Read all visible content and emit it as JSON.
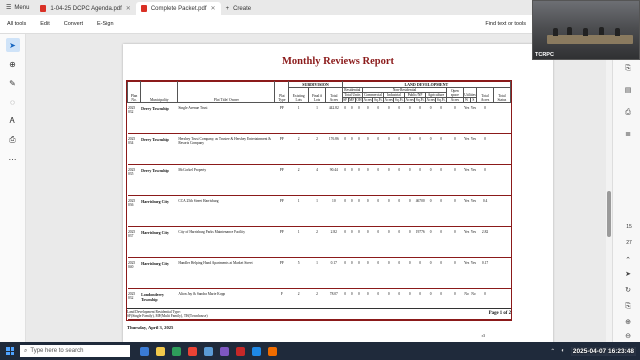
{
  "browser": {
    "menu_label": "Menu",
    "tabs": [
      {
        "label": "1-04-25 DCPC Agenda.pdf",
        "active": false
      },
      {
        "label": "Complete Packet.pdf",
        "active": true
      },
      {
        "label": "Create",
        "active": false
      }
    ]
  },
  "toolbar": {
    "items": [
      "All tools",
      "Edit",
      "Convert",
      "E-Sign"
    ],
    "find_label": "Find text or tools"
  },
  "report": {
    "title": "Monthly Reviews Report",
    "group_headers": {
      "subdivision": "SUBDIVISION",
      "land_development": "LAND DEVELOPMENT"
    },
    "sub_headers": {
      "residential": "Residential",
      "non_residential": "Non-Residential",
      "total_units": "Total Units",
      "commercial": "Commercial",
      "industrial": "Industrial",
      "public_np": "Public/NP",
      "agriculture": "Agriculture",
      "open_space": "Open space",
      "utilities": "Utilities"
    },
    "columns": {
      "plan_no": "Plan No.",
      "municipality": "Municipality",
      "plot_title_owner": "Plot Title/ Owner",
      "plat_type": "Plat Type",
      "existing_lots": "Existing Lots",
      "final_lots": "Final # Lots",
      "total_acres": "Total Acres",
      "sf": "SF",
      "mf": "MF",
      "oh": "OH",
      "acres": "Acres",
      "sqft": "Sq.Ft.",
      "w": "W",
      "s": "S",
      "total_acres2": "Total Acres",
      "total_status": "Total Status"
    },
    "rows": [
      {
        "plan": "2025 032",
        "municipality": "Derry Township",
        "owner": "Single Avenue Trust",
        "type": "PF",
        "existing": "1",
        "final": "1",
        "acres": "442.82",
        "sf": "0",
        "mf": "0",
        "oh": "0",
        "c_ac": "0",
        "c_sf": "0",
        "i_ac": "0",
        "i_sf": "0",
        "p_ac": "0",
        "p_sf": "0",
        "a_ac": "0",
        "a_sf": "0",
        "os": "0",
        "w": "Yes",
        "s": "Yes",
        "total": "0",
        "status": ""
      },
      {
        "plan": "2025 034",
        "municipality": "Derry Township",
        "owner": "Hershey Trust Company, as Trustee & Hershey Entertainment & Resorts Company",
        "type": "PF",
        "existing": "2",
        "final": "2",
        "acres": "176.86",
        "sf": "0",
        "mf": "0",
        "oh": "0",
        "c_ac": "0",
        "c_sf": "0",
        "i_ac": "0",
        "i_sf": "0",
        "p_ac": "0",
        "p_sf": "0",
        "a_ac": "0",
        "a_sf": "0",
        "os": "0",
        "w": "Yes",
        "s": "Yes",
        "total": "0",
        "status": ""
      },
      {
        "plan": "2025 035",
        "municipality": "Derry Township",
        "owner": "McCorkel Property",
        "type": "PF",
        "existing": "2",
        "final": "4",
        "acres": "90.44",
        "sf": "0",
        "mf": "0",
        "oh": "0",
        "c_ac": "0",
        "c_sf": "0",
        "i_ac": "0",
        "i_sf": "0",
        "p_ac": "0",
        "p_sf": "0",
        "a_ac": "0",
        "a_sf": "0",
        "os": "0",
        "w": "Yes",
        "s": "Yes",
        "total": "0",
        "status": ""
      },
      {
        "plan": "2025 036",
        "municipality": "Harrisburg City",
        "owner": "CCA 25th Street Harrisburg",
        "type": "PF",
        "existing": "1",
        "final": "1",
        "acres": "10",
        "sf": "0",
        "mf": "0",
        "oh": "0",
        "c_ac": "0",
        "c_sf": "0",
        "i_ac": "0",
        "i_sf": "0",
        "p_ac": "0",
        "p_sf": "46700",
        "a_ac": "0",
        "a_sf": "0",
        "os": "0",
        "w": "Yes",
        "s": "Yes",
        "total": "0.4",
        "status": ""
      },
      {
        "plan": "2025 037",
        "municipality": "Harrisburg City",
        "owner": "City of Harrisburg Parks Maintenance Facility",
        "type": "PF",
        "existing": "1",
        "final": "2",
        "acres": "2.82",
        "sf": "0",
        "mf": "0",
        "oh": "0",
        "c_ac": "0",
        "c_sf": "0",
        "i_ac": "0",
        "i_sf": "0",
        "p_ac": "0",
        "p_sf": "19776",
        "a_ac": "0",
        "a_sf": "0",
        "os": "0",
        "w": "Yes",
        "s": "Yes",
        "total": "2.82",
        "status": ""
      },
      {
        "plan": "2025 040",
        "municipality": "Harrisburg City",
        "owner": "Handler Helping Hand Apartments at Market Street",
        "type": "PF",
        "existing": "5",
        "final": "1",
        "acres": "0.17",
        "sf": "0",
        "mf": "0",
        "oh": "0",
        "c_ac": "0",
        "c_sf": "0",
        "i_ac": "0",
        "i_sf": "0",
        "p_ac": "0",
        "p_sf": "0",
        "a_ac": "0",
        "a_sf": "0",
        "os": "0",
        "w": "Yes",
        "s": "Yes",
        "total": "0.17",
        "status": ""
      },
      {
        "plan": "2025 032",
        "municipality": "Londonderry Township",
        "owner": "Alton Jay & Sandra Marie Kopp",
        "type": "F",
        "existing": "2",
        "final": "2",
        "acres": "78.07",
        "sf": "0",
        "mf": "0",
        "oh": "0",
        "c_ac": "0",
        "c_sf": "0",
        "i_ac": "0",
        "i_sf": "0",
        "p_ac": "0",
        "p_sf": "0",
        "a_ac": "0",
        "a_sf": "0",
        "os": "0",
        "w": "No",
        "s": "No",
        "total": "0",
        "status": ""
      }
    ],
    "footer": {
      "line1": "Land Development Residential Type:",
      "line2": "SF(Single Family), MF(Multi Family), TH(Townhouse)",
      "page": "Page 1 of 2",
      "date": "Thursday, April 3, 2025",
      "initials": "r3"
    }
  },
  "right_rail": {
    "page_current": "15",
    "page_total": "27"
  },
  "video": {
    "label": "TCRPC"
  },
  "taskbar": {
    "search_placeholder": "Type here to search",
    "clock": "2025-04-07 16:23:48"
  }
}
